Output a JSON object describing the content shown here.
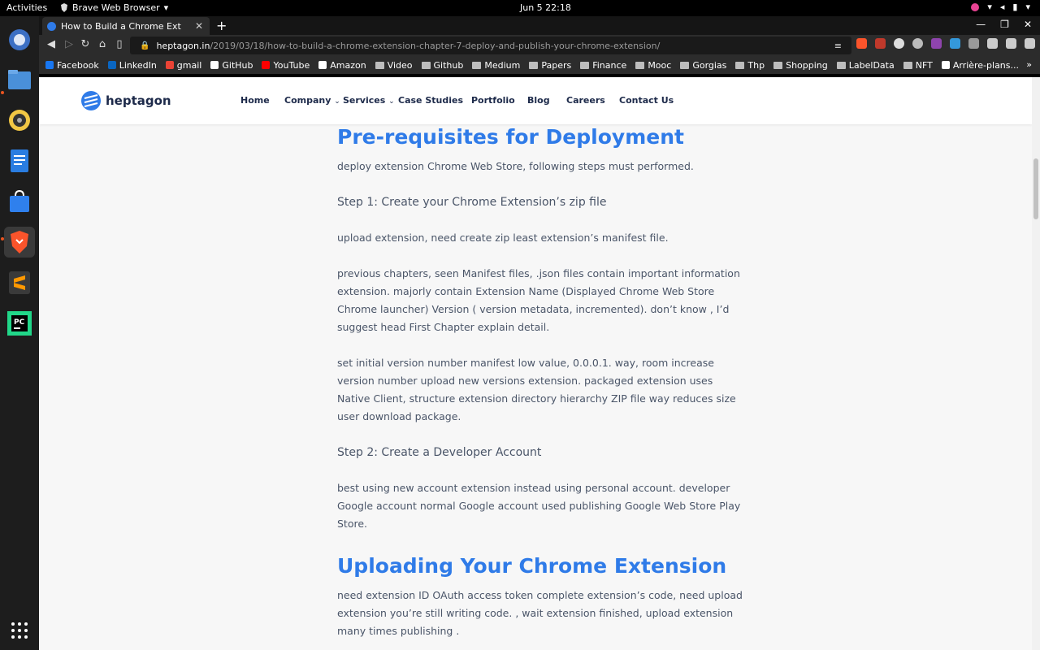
{
  "topbar": {
    "activities": "Activities",
    "app_name": "Brave Web Browser",
    "clock": "Jun 5  22:18"
  },
  "browser": {
    "tab_title": "How to Build a Chrome Ext",
    "url_host": "heptagon.in",
    "url_path": "/2019/03/18/how-to-build-a-chrome-extension-chapter-7-deploy-and-publish-your-chrome-extension/",
    "bookmarks": [
      {
        "label": "Facebook",
        "color": "#1877f2",
        "type": "site"
      },
      {
        "label": "LinkedIn",
        "color": "#0a66c2",
        "type": "site"
      },
      {
        "label": "gmail",
        "color": "#ea4335",
        "type": "site"
      },
      {
        "label": "GitHub",
        "color": "#ffffff",
        "type": "site"
      },
      {
        "label": "YouTube",
        "color": "#ff0000",
        "type": "site"
      },
      {
        "label": "Amazon",
        "color": "#ffffff",
        "type": "site"
      },
      {
        "label": "Video",
        "type": "folder"
      },
      {
        "label": "Github",
        "type": "folder"
      },
      {
        "label": "Medium",
        "type": "folder"
      },
      {
        "label": "Papers",
        "type": "folder"
      },
      {
        "label": "Finance",
        "type": "folder"
      },
      {
        "label": "Mooc",
        "type": "folder"
      },
      {
        "label": "Gorgias",
        "type": "folder"
      },
      {
        "label": "Thp",
        "type": "folder"
      },
      {
        "label": "Shopping",
        "type": "folder"
      },
      {
        "label": "LabelData",
        "type": "folder"
      },
      {
        "label": "NFT",
        "type": "folder"
      },
      {
        "label": "Arrière-plans...",
        "type": "site",
        "color": "#ffffff"
      }
    ],
    "bookmarks_more": "»"
  },
  "site": {
    "logo_text": "heptagon",
    "nav": [
      "Home",
      "Company",
      "Services",
      "Case Studies",
      "Portfolio",
      "Blog",
      "Careers",
      "Contact Us"
    ]
  },
  "article": {
    "heading1": "Pre-requisites for Deployment",
    "intro": "deploy extension Chrome Web Store, following steps must performed.",
    "step1": "Step 1: Create your Chrome Extension’s zip file",
    "p1": "upload extension, need create zip least extension’s manifest file.",
    "p2": "previous chapters, seen Manifest files, .json files contain important information extension. majorly contain Extension Name (Displayed Chrome Web Store Chrome launcher) Version ( version metadata, incremented). don’t know , I’d suggest head First Chapter explain detail.",
    "p3": "set initial version number manifest low value, 0.0.0.1. way, room increase version number upload new versions extension. packaged extension uses Native Client, structure extension directory hierarchy ZIP file way reduces size user download package.",
    "step2": "Step 2: Create a Developer Account",
    "p4": "best using new account extension instead using personal account. developer Google account normal Google account used publishing Google Web Store Play Store.",
    "heading2": "Uploading Your Chrome Extension",
    "p5": "need extension ID OAuth access token complete extension’s code, need upload extension you’re still writing code. , wait extension finished, upload extension many times publishing ."
  },
  "colors": {
    "accent": "#2f7be8",
    "brave": "#fb542b"
  }
}
